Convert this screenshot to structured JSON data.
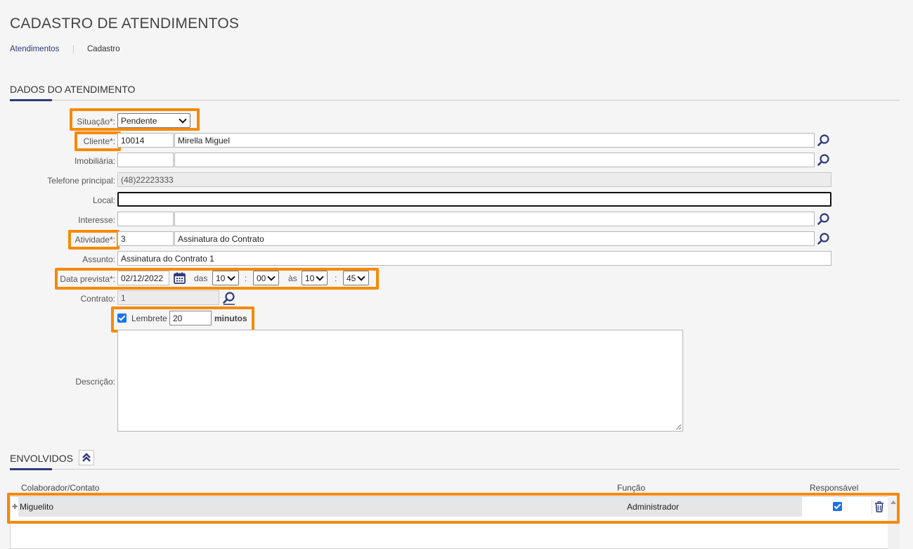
{
  "page": {
    "title": "CADASTRO DE ATENDIMENTOS",
    "breadcrumb": {
      "link": "Atendimentos",
      "current": "Cadastro"
    }
  },
  "dados": {
    "section_title": "DADOS DO ATENDIMENTO",
    "situacao": {
      "label": "Situação*:",
      "value": "Pendente"
    },
    "cliente": {
      "label": "Cliente*:",
      "code": "10014",
      "name": "Mirella Miguel"
    },
    "imobiliaria": {
      "label": "Imobiliária:",
      "code": "",
      "name": ""
    },
    "telefone": {
      "label": "Telefone principal:",
      "value": "(48)22223333"
    },
    "local": {
      "label": "Local:",
      "value": ""
    },
    "interesse": {
      "label": "Interesse:",
      "code": "",
      "name": ""
    },
    "atividade": {
      "label": "Atividade*:",
      "code": "3",
      "name": "Assinatura do Contrato"
    },
    "assunto": {
      "label": "Assunto:",
      "value": "Assinatura do Contrato 1"
    },
    "data_prevista": {
      "label": "Data prevista*:",
      "date": "02/12/2022",
      "das_label": "das",
      "start_hour": "10",
      "start_min": "00",
      "sep": ":",
      "as_label": "às",
      "end_hour": "10",
      "end_min": "45"
    },
    "contrato": {
      "label": "Contrato:",
      "value": "1"
    },
    "lembrete": {
      "label": "Lembrete",
      "value": "20",
      "unit": "minutos",
      "checked": true
    },
    "descricao": {
      "label": "Descrição:",
      "value": ""
    }
  },
  "envolvidos": {
    "section_title": "ENVOLVIDOS",
    "columns": [
      "Colaborador/Contato",
      "Função",
      "Responsável"
    ],
    "rows": [
      {
        "nome": "Miguelito",
        "funcao": "Administrador",
        "responsavel": true
      }
    ]
  },
  "colors": {
    "accent": "#2d3a7a",
    "highlight": "#f58a07",
    "checkbox": "#1a73e8"
  },
  "icons": [
    "search-icon",
    "calendar-icon",
    "chevron-down-icon",
    "collapse-up-icon",
    "trash-icon",
    "expand-plus-icon"
  ]
}
